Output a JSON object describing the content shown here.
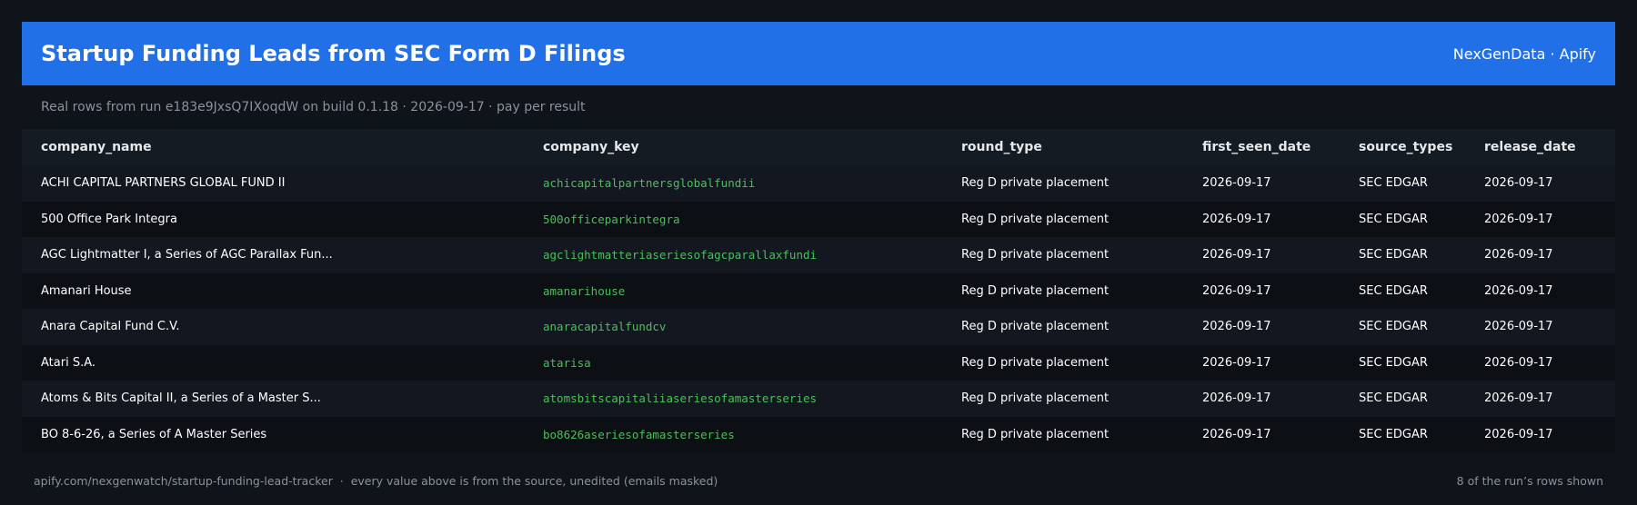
{
  "header": {
    "title": "Startup Funding Leads from SEC Form D Filings",
    "brand": "NexGenData · Apify"
  },
  "subtitle": "Real rows from run e183e9JxsQ7IXoqdW on build 0.1.18 · 2026-09-17 · pay per result",
  "table": {
    "columns": [
      "company_name",
      "company_key",
      "round_type",
      "first_seen_date",
      "source_types",
      "release_date"
    ],
    "rows": [
      [
        "ACHI CAPITAL PARTNERS GLOBAL FUND II",
        "achicapitalpartnersglobalfundii",
        "Reg D private placement",
        "2026-09-17",
        "SEC EDGAR",
        "2026-09-17"
      ],
      [
        "500 Office Park Integra",
        "500officeparkintegra",
        "Reg D private placement",
        "2026-09-17",
        "SEC EDGAR",
        "2026-09-17"
      ],
      [
        "AGC Lightmatter I, a Series of AGC Parallax Fun...",
        "agclightmatteriaseriesofagcparallaxfundi",
        "Reg D private placement",
        "2026-09-17",
        "SEC EDGAR",
        "2026-09-17"
      ],
      [
        "Amanari House",
        "amanarihouse",
        "Reg D private placement",
        "2026-09-17",
        "SEC EDGAR",
        "2026-09-17"
      ],
      [
        "Anara Capital Fund C.V.",
        "anaracapitalfundcv",
        "Reg D private placement",
        "2026-09-17",
        "SEC EDGAR",
        "2026-09-17"
      ],
      [
        "Atari S.A.",
        "atarisa",
        "Reg D private placement",
        "2026-09-17",
        "SEC EDGAR",
        "2026-09-17"
      ],
      [
        "Atoms & Bits Capital II, a Series of a Master S...",
        "atomsbitscapitaliiaseriesofamasterseries",
        "Reg D private placement",
        "2026-09-17",
        "SEC EDGAR",
        "2026-09-17"
      ],
      [
        "BO 8-6-26, a Series of A Master Series",
        "bo8626aseriesofamasterseries",
        "Reg D private placement",
        "2026-09-17",
        "SEC EDGAR",
        "2026-09-17"
      ]
    ]
  },
  "footer": {
    "left": "apify.com/nexgenwatch/startup-funding-lead-tracker  ·  every value above is from the source, unedited (emails masked)",
    "right": "8 of the run’s rows shown"
  },
  "colors": {
    "background": "#0f131a",
    "header": "#2170e8",
    "key_text": "#4bbf5a",
    "muted_text": "#8b929c"
  }
}
